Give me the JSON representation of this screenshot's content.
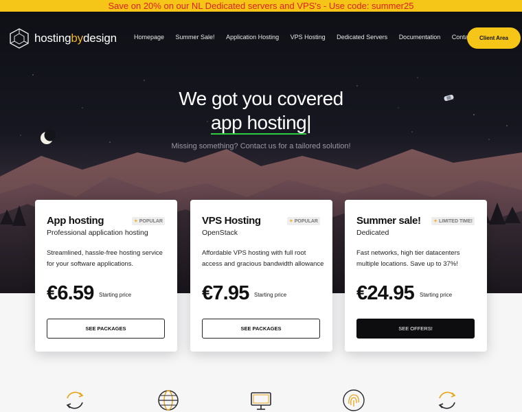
{
  "promo": {
    "text": "Save on 20% on our NL Dedicated servers and VPS's - Use code: summer25"
  },
  "brand": {
    "name_part1": "hosting",
    "name_accent": "by",
    "name_part2": "design"
  },
  "nav": {
    "items": [
      "Homepage",
      "Summer Sale!",
      "Application Hosting",
      "VPS Hosting",
      "Dedicated Servers",
      "Documentation",
      "Contact Us"
    ],
    "client_area": "Client Area"
  },
  "hero": {
    "headline": "We got you covered",
    "typed_word": "app hosting",
    "cursor": "|",
    "subtitle": "Missing something? Contact us for a tailored solution!"
  },
  "cards": [
    {
      "title": "App hosting",
      "badge": "POPULAR",
      "subtitle": "Professional application hosting",
      "description": "Streamlined, hassle-free hosting service for your software applications.",
      "price": "€6.59",
      "price_note": "Starting price",
      "button": "SEE PACKAGES"
    },
    {
      "title": "VPS Hosting",
      "badge": "POPULAR",
      "subtitle": "OpenStack",
      "description": "Affordable VPS hosting with full root access and gracious bandwidth allowance",
      "price": "€7.95",
      "price_note": "Starting price",
      "button": "SEE PACKAGES"
    },
    {
      "title": "Summer sale!",
      "badge": "LIMITED TIME!",
      "subtitle": "Dedicated",
      "description": "Fast networks, high tier datacenters multiple locations. Save up to 37%!",
      "price": "€24.95",
      "price_note": "Starting price",
      "button": "SEE OFFERS!"
    }
  ],
  "features": {
    "icons": [
      "sync-icon",
      "globe-icon",
      "monitor-icon",
      "fingerprint-icon",
      "sync-icon"
    ]
  },
  "colors": {
    "accent": "#f5c518",
    "promo_text": "#e0201b",
    "typed_underline": "#2ecc40"
  }
}
